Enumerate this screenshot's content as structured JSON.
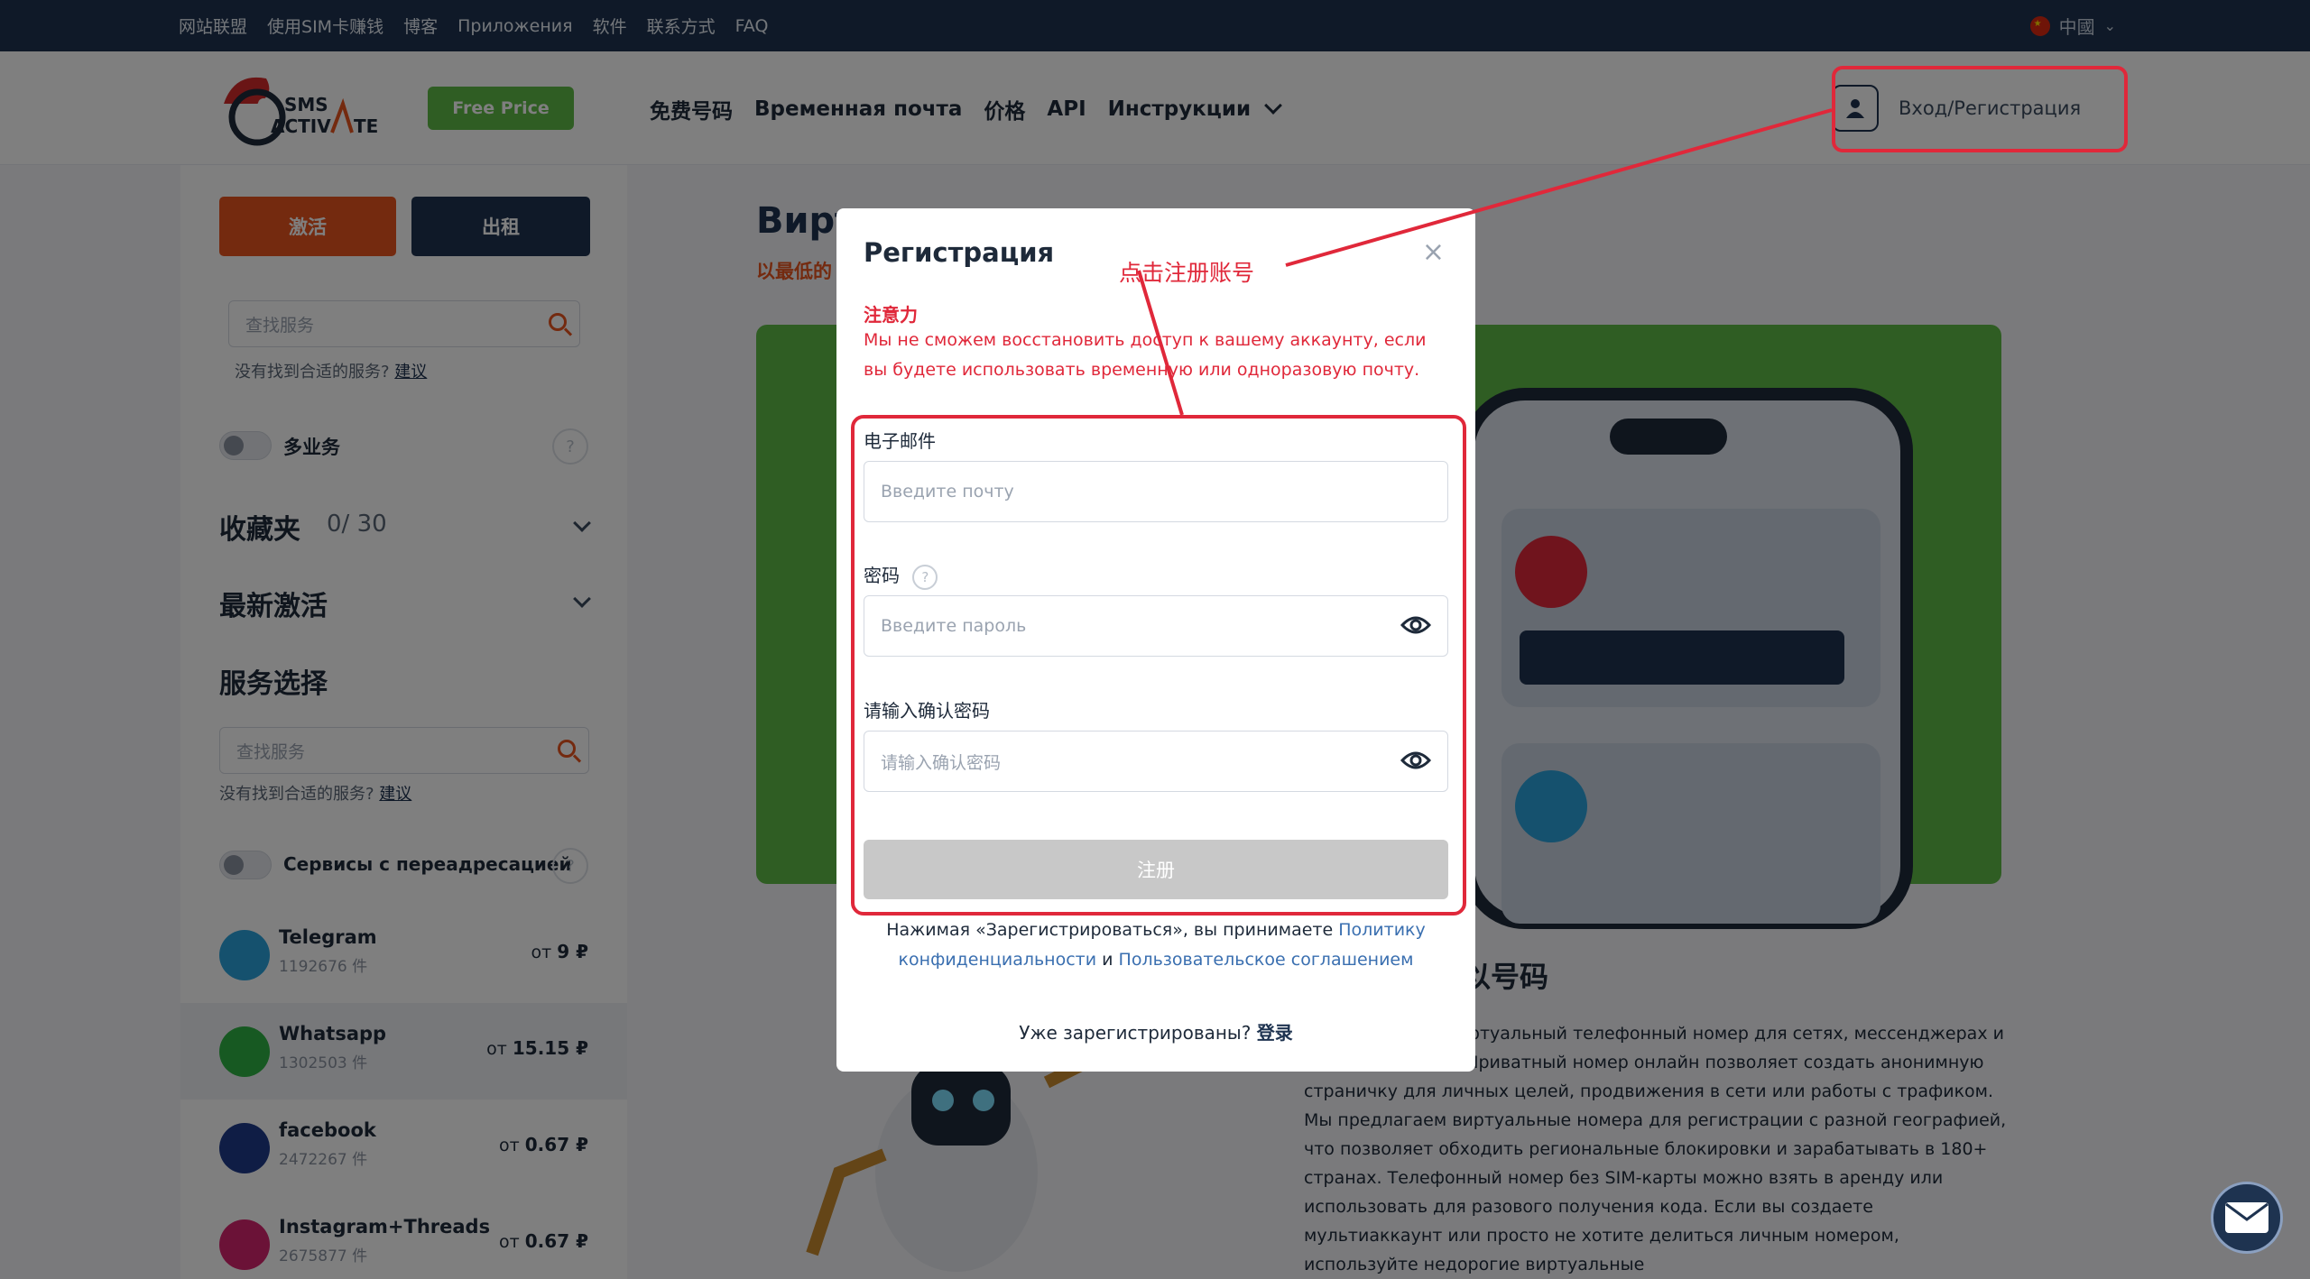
{
  "topbar": {
    "links": [
      "网站联盟",
      "使用SIM卡赚钱",
      "博客",
      "Приложения",
      "软件",
      "联系方式",
      "FAQ"
    ],
    "language": "中國"
  },
  "header": {
    "free_price": "Free Price",
    "nav": [
      "免费号码",
      "Временная почта",
      "价格",
      "API",
      "Инструкции"
    ],
    "login_label": "Вход/Регистрация"
  },
  "sidebar": {
    "activate_btn": "激活",
    "rent_btn": "出租",
    "search_placeholder": "查找服务",
    "not_found": "没有找到合适的服务?",
    "suggest": "建议",
    "multi_label": "多业务",
    "favorites_label": "收藏夹",
    "favorites_count": "0/ 30",
    "recent_label": "最新激活",
    "service_select": "服务选择",
    "redirect_label": "Сервисы с переадресацией",
    "services": [
      {
        "name": "Telegram",
        "count": "1192676 件",
        "price_prefix": "от",
        "price": "9 ₽",
        "color": "#2aa3dc"
      },
      {
        "name": "Whatsapp",
        "count": "1302503 件",
        "price_prefix": "от",
        "price": "15.15 ₽",
        "color": "#2fb344"
      },
      {
        "name": "facebook",
        "count": "2472267 件",
        "price_prefix": "от",
        "price": "0.67 ₽",
        "color": "#1e3a8a"
      },
      {
        "name": "Instagram+Threads",
        "count": "2675877 件",
        "price_prefix": "от",
        "price": "0.67 ₽",
        "color": "#d6246e"
      }
    ]
  },
  "content": {
    "title": "Вирт",
    "subtitle": "以最低的",
    "article_title": "以号码",
    "article_text": "можете купить виртуальный телефонный номер для сетях, мессенджерах и других сервисах. Приватный номер онлайн позволяет создать анонимную страничку для личных целей, продвижения в сети или работы с трафиком. Мы предлагаем виртуальные номера для регистрации с разной географией, что позволяет обходить региональные блокировки и зарабатывать в 180+ странах. Телефонный номер без SIM-карты можно взять в аренду или использовать для разового получения кода. Если вы создаете мультиаккаунт или просто не хотите делиться личным номером, используйте недорогие виртуальные"
  },
  "modal": {
    "title": "Регистрация",
    "close": "×",
    "warn_title": "注意力",
    "warn_text": "Мы не сможем восстановить доступ к вашему аккаунту, если вы будете использовать временную или одноразовую почту.",
    "email_label": "电子邮件",
    "email_placeholder": "Введите почту",
    "password_label": "密码",
    "password_help": "?",
    "password_placeholder": "Введите пароль",
    "confirm_label": "请输入确认密码",
    "confirm_placeholder": "请输入确认密码",
    "submit": "注册",
    "terms_prefix": "Нажимая «Зарегистрироваться», вы принимаете",
    "terms_privacy": "Политику конфиденциальности",
    "terms_and": "и",
    "terms_agreement": "Пользовательское соглашением",
    "already": "Уже зарегистрированы?",
    "login_link": "登录"
  },
  "annotation": {
    "text": "点击注册账号",
    "color": "#e0283a"
  }
}
